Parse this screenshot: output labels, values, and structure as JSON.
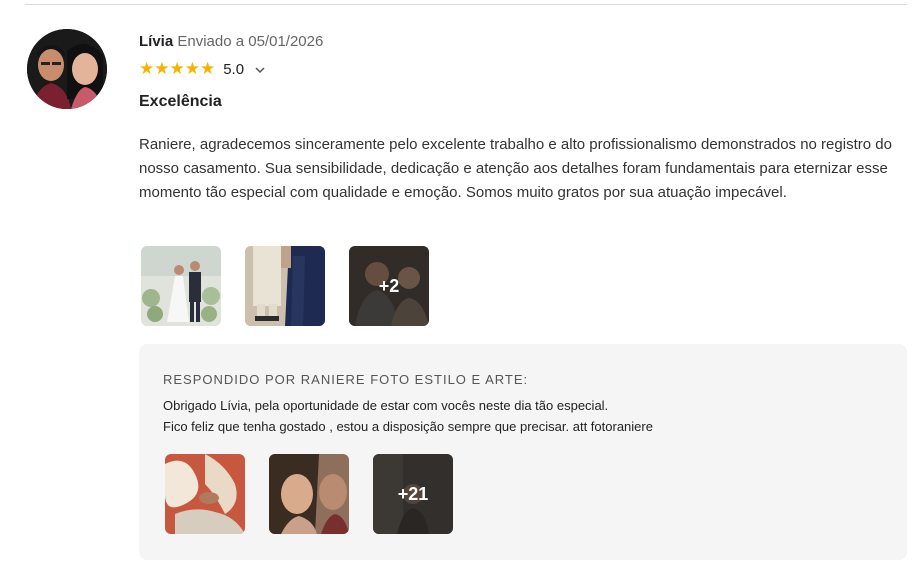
{
  "review": {
    "author": "Lívia",
    "sent_label": "Enviado a 05/01/2026",
    "stars": "★★★★★",
    "rating": "5.0",
    "rating_value": 5.0,
    "title": "Excelência",
    "body": "Raniere, agradecemos sinceramente pelo excelente trabalho e alto profissionalismo demonstrados no registro do nosso casamento. Sua sensibilidade, dedicação e atenção aos detalhes foram fundamentais para eternizar esse momento tão especial com qualidade e emoção. Somos muito gratos por sua atuação impecável.",
    "photos_more": "+2"
  },
  "reply": {
    "heading": "RESPONDIDO POR RANIERE FOTO ESTILO E ARTE:",
    "line1": "Obrigado Lívia, pela oportunidade de estar com vocês neste dia tão especial.",
    "line2": "Fico feliz que tenha gostado , estou a disposição sempre que precisar. att fotoraniere",
    "photos_more": "+21"
  },
  "colors": {
    "star": "#f5b301",
    "reply_background": "#f5f5f5"
  },
  "icons": {
    "rating_expand": "chevron-down-icon"
  }
}
